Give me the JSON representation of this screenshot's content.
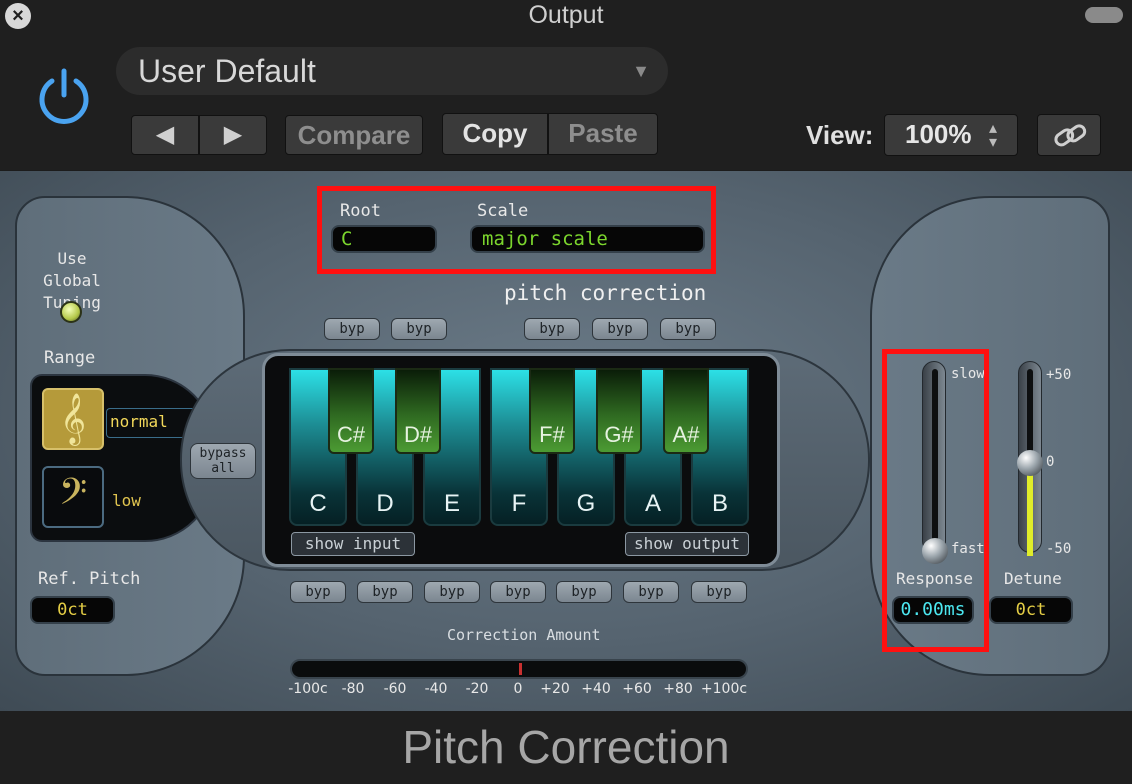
{
  "header": {
    "window_title": "Output",
    "preset": "User Default",
    "nav_prev": "◀",
    "nav_next": "▶",
    "compare": "Compare",
    "copy": "Copy",
    "paste": "Paste",
    "view_label": "View:",
    "view_value": "100%"
  },
  "plugin": {
    "name": "Pitch Correction",
    "use_global_tuning": "Use Global Tuning",
    "range_label": "Range",
    "range_options": {
      "normal": "normal",
      "low": "low"
    },
    "ref_pitch_label": "Ref. Pitch",
    "ref_pitch_value": "0ct",
    "root_label": "Root",
    "root_value": "C",
    "scale_label": "Scale",
    "scale_value": "major scale",
    "section_label": "pitch correction",
    "bypass_all": "bypass all",
    "byp": "byp",
    "white_keys": [
      "C",
      "D",
      "E",
      "F",
      "G",
      "A",
      "B"
    ],
    "black_keys": [
      "C#",
      "D#",
      "F#",
      "G#",
      "A#"
    ],
    "show_input": "show input",
    "show_output": "show output",
    "correction_amount_label": "Correction Amount",
    "correction_ticks": [
      "-100c",
      "-80",
      "-60",
      "-40",
      "-20",
      "0",
      "+20",
      "+40",
      "+60",
      "+80",
      "+100c"
    ],
    "response": {
      "label": "Response",
      "value": "0.00ms",
      "slow": "slow",
      "fast": "fast"
    },
    "detune": {
      "label": "Detune",
      "value": "0ct",
      "max": "+50",
      "mid": "0",
      "min": "-50"
    }
  },
  "colors": {
    "display_green": "#7cd62d",
    "display_cyan": "#4ce7f0",
    "display_yellow": "#e4cd45",
    "highlight_red": "#ff1010"
  },
  "icons": [
    "close-icon",
    "power-icon",
    "chevron-down-icon",
    "arrow-left-icon",
    "arrow-right-icon",
    "link-icon",
    "treble-clef-icon",
    "bass-clef-icon"
  ]
}
